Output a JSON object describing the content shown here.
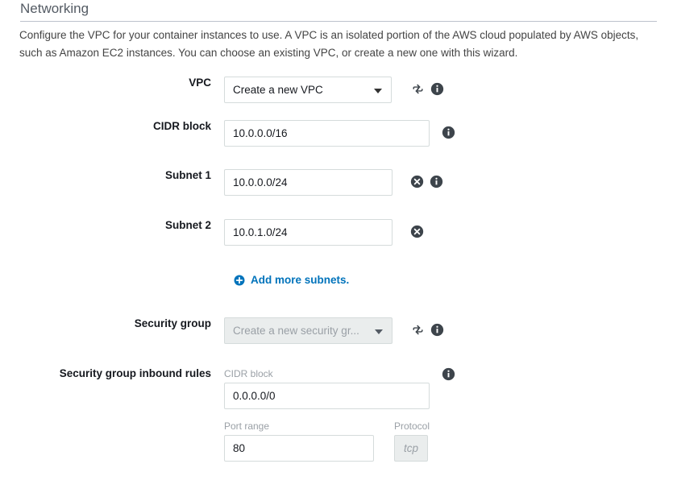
{
  "section": {
    "title": "Networking",
    "description": "Configure the VPC for your container instances to use. A VPC is an isolated portion of the AWS cloud populated by AWS objects, such as Amazon EC2 instances. You can choose an existing VPC, or create a new one with this wizard."
  },
  "fields": {
    "vpc": {
      "label": "VPC",
      "selected": "Create a new VPC",
      "refresh_icon": "refresh-icon",
      "info_icon": "info-icon"
    },
    "cidr_block": {
      "label": "CIDR block",
      "value": "10.0.0.0/16",
      "info_icon": "info-icon"
    },
    "subnet_1": {
      "label": "Subnet 1",
      "value": "10.0.0.0/24",
      "remove_icon": "remove-circle-icon",
      "info_icon": "info-icon"
    },
    "subnet_2": {
      "label": "Subnet 2",
      "value": "10.0.1.0/24",
      "remove_icon": "remove-circle-icon"
    },
    "add_subnets": {
      "label": "Add more subnets.",
      "icon": "add-circle-icon"
    },
    "security_group": {
      "label": "Security group",
      "selected": "Create a new security gr...",
      "disabled": true,
      "refresh_icon": "refresh-icon",
      "info_icon": "info-icon"
    },
    "inbound_rules": {
      "label": "Security group inbound rules",
      "info_icon": "info-icon",
      "cidr_block": {
        "sub_label": "CIDR block",
        "value": "0.0.0.0/0"
      },
      "port_range": {
        "sub_label": "Port range",
        "value": "80"
      },
      "protocol": {
        "sub_label": "Protocol",
        "value": "tcp",
        "disabled": true
      }
    }
  },
  "colors": {
    "link": "#0073bb",
    "title": "#545b64",
    "text": "#16191f",
    "border": "#d5dbdb",
    "disabled_bg": "#eaeded"
  }
}
